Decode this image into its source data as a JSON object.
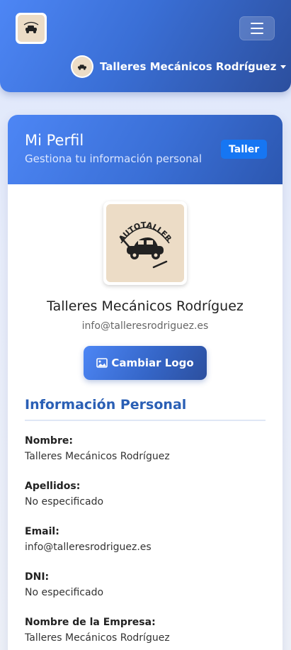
{
  "navbar": {
    "logo_text": "AUTOTALLER",
    "user_name": "Talleres Mecánicos Rodríguez"
  },
  "profile_card": {
    "title": "Mi Perfil",
    "subtitle": "Gestiona tu información personal",
    "role_badge": "Taller",
    "logo_text": "AUTOTALLER",
    "name": "Talleres Mecánicos Rodríguez",
    "email": "info@talleresrodriguez.es",
    "change_logo_label": "Cambiar Logo"
  },
  "personal_info": {
    "title": "Información Personal",
    "fields": [
      {
        "label": "Nombre:",
        "value": "Talleres Mecánicos Rodríguez"
      },
      {
        "label": "Apellidos:",
        "value": "No especificado"
      },
      {
        "label": "Email:",
        "value": "info@talleresrodriguez.es"
      },
      {
        "label": "DNI:",
        "value": "No especificado"
      },
      {
        "label": "Nombre de la Empresa:",
        "value": "Talleres Mecánicos Rodríguez"
      }
    ]
  },
  "colors": {
    "primary": "#3a6fd6",
    "badge": "#1676f3",
    "section_title": "#2a5fb5"
  }
}
